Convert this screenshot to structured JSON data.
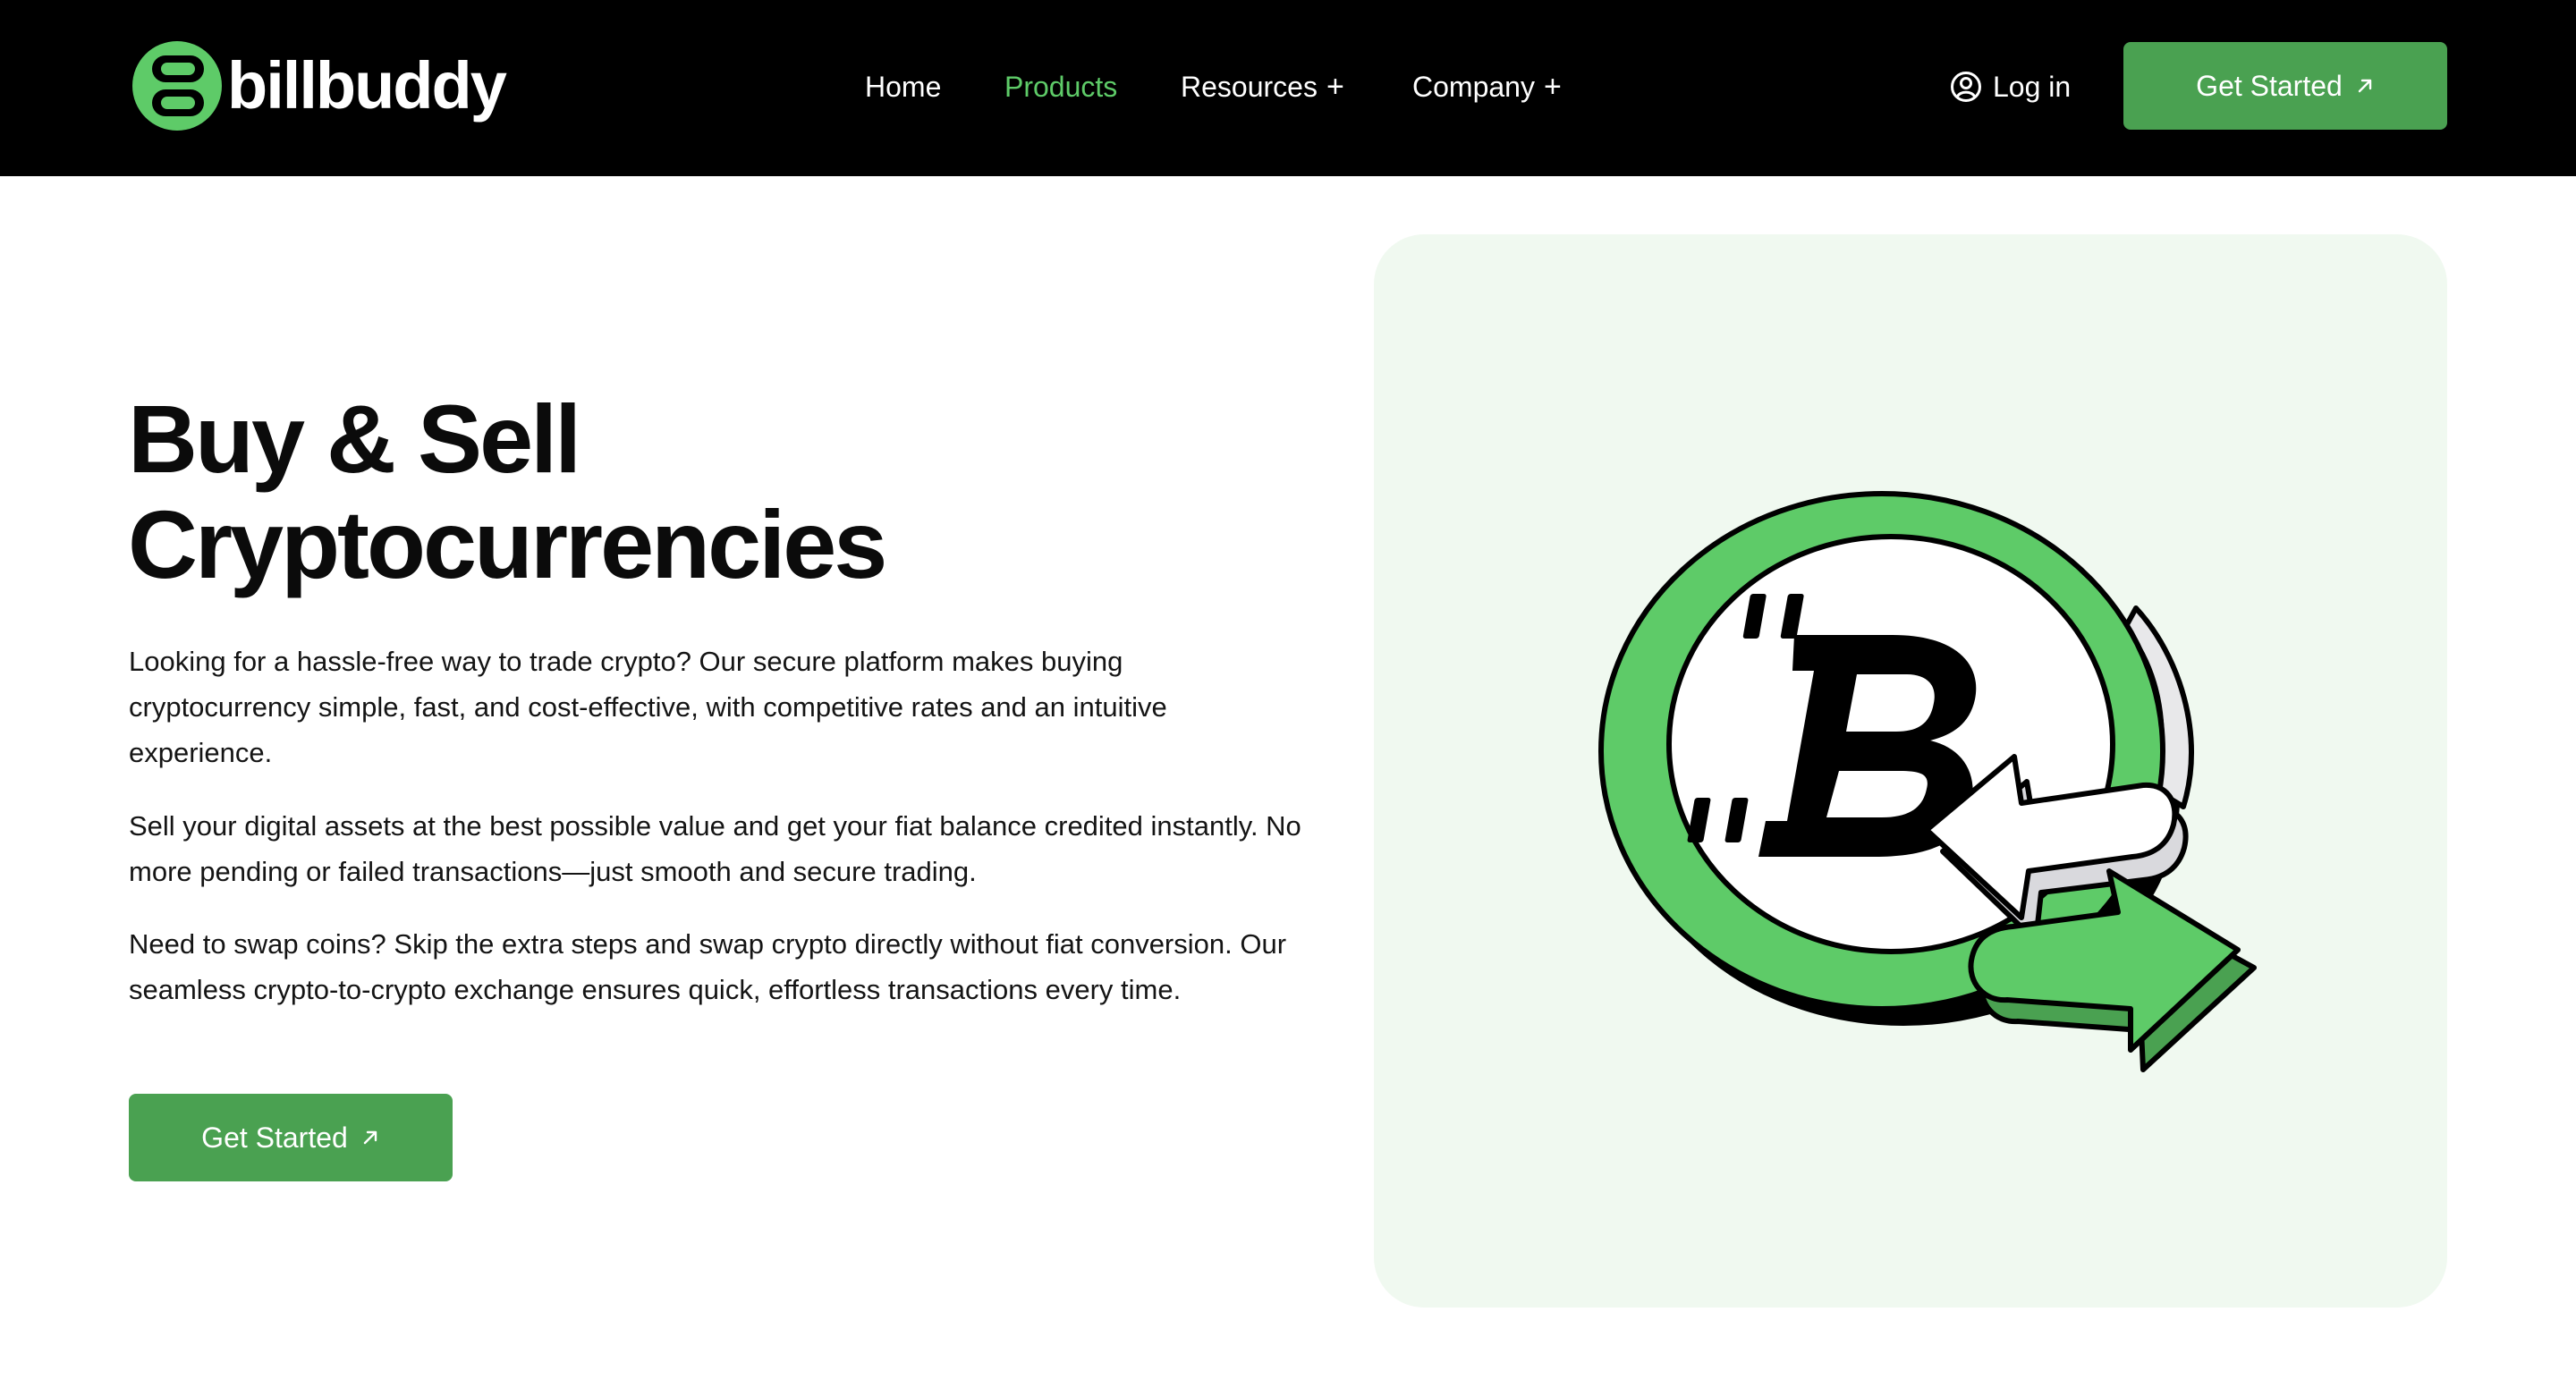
{
  "brand": {
    "name": "billbuddy",
    "accent_color": "#5ecb68",
    "button_color": "#4aa151",
    "logo_icon": "billbuddy-b-logo-icon"
  },
  "nav": {
    "items": [
      {
        "label": "Home",
        "active": false
      },
      {
        "label": "Products",
        "active": true
      },
      {
        "label": "Resources",
        "expandable": true
      },
      {
        "label": "Company",
        "expandable": true
      }
    ],
    "expand_symbol": "+",
    "login_label": "Log in",
    "login_icon": "user-circle-icon",
    "cta_label": "Get Started",
    "cta_icon": "arrow-up-right-icon"
  },
  "hero": {
    "title_line1": "Buy & Sell",
    "title_line2": "Cryptocurrencies",
    "paragraphs": [
      "Looking for a hassle-free way to trade crypto? Our secure platform makes buying cryptocurrency simple, fast, and cost-effective, with competitive rates and an intuitive experience.",
      "Sell your digital assets at the best possible value and get your fiat balance credited instantly. No more pending or failed transactions—just smooth and secure trading.",
      "Need to swap coins? Skip the extra steps and swap crypto directly without fiat conversion. Our seamless crypto-to-crypto exchange ensures quick, effortless transactions every time."
    ],
    "cta_label": "Get Started",
    "illustration": "bitcoin-exchange-arrows-illustration",
    "panel_color": "#f0f9f0"
  }
}
